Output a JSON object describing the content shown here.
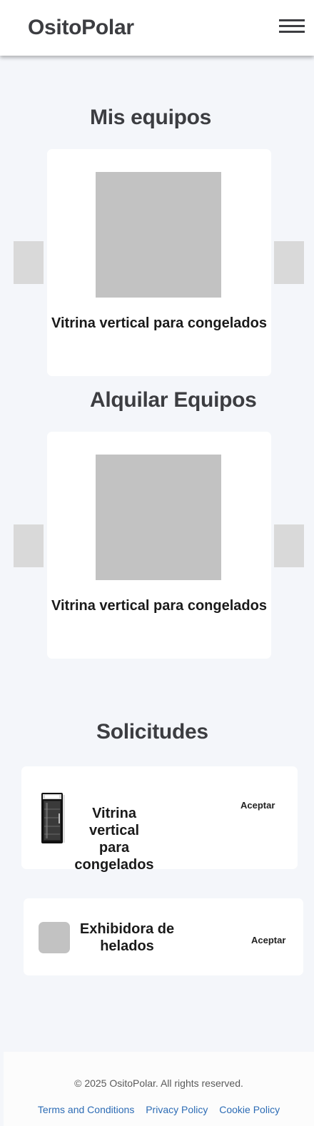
{
  "header": {
    "brand": "OsitoPolar",
    "menu_icon": "hamburger-menu-icon"
  },
  "my_equipment": {
    "title": "Mis equipos",
    "item": {
      "label": "Vitrina vertical para congelados"
    }
  },
  "rent_equipment": {
    "title": "Alquilar Equipos",
    "item": {
      "label": "Vitrina vertical para congelados"
    }
  },
  "requests": {
    "title": "Solicitudes",
    "items": [
      {
        "label": "Vitrina vertical para congelados",
        "action": "Aceptar",
        "image": "display-fridge-icon"
      },
      {
        "label": "Exhibidora de helados",
        "action": "Aceptar",
        "image": "placeholder-image"
      }
    ]
  },
  "footer": {
    "copyright": "© 2025 OsitoPolar. All rights reserved.",
    "links": [
      "Terms and Conditions",
      "Privacy Policy",
      "Cookie Policy"
    ]
  },
  "colors": {
    "background": "#f4f6fa",
    "card": "#ffffff",
    "text": "#3c3d41",
    "link": "#2d6cb5",
    "placeholder": "#c2c2c2"
  }
}
